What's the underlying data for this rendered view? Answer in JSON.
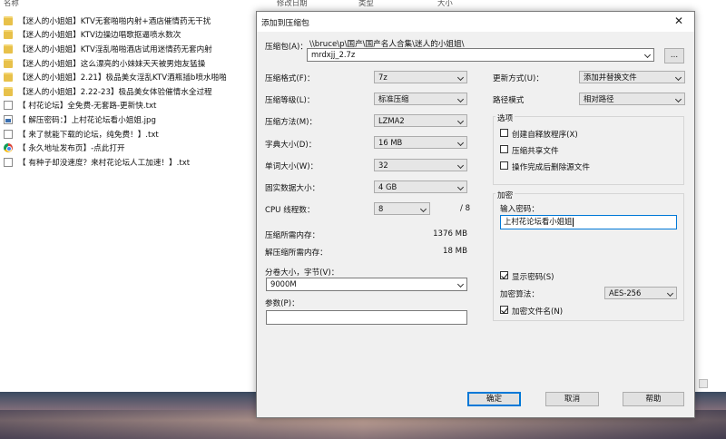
{
  "explorer": {
    "columns": [
      "名称",
      "修改日期",
      "类型",
      "大小"
    ],
    "files": [
      {
        "icon": "folder-icon",
        "name": "【迷人的小姐姐】KTV无套啪啪内射+酒店催情药无干扰"
      },
      {
        "icon": "folder-icon",
        "name": "【迷人的小姐姐】KTV边操边唱歌抠逼喷水数次"
      },
      {
        "icon": "folder-icon",
        "name": "【迷人的小姐姐】KTV淫乱啪啪酒店试用迷情药无套内射"
      },
      {
        "icon": "folder-icon",
        "name": "【迷人的小姐姐】这么漂亮的小妹妹天天被男炮友猛操"
      },
      {
        "icon": "folder-icon",
        "name": "【迷人的小姐姐】2.21】极品美女淫乱KTV酒瓶插b喷水啪啪"
      },
      {
        "icon": "folder-icon",
        "name": "【迷人的小姐姐】2.22-23】极品美女体验催情水全过程"
      },
      {
        "icon": "document-icon",
        "name": "【 村花论坛】全免费-无套路-更新快.txt"
      },
      {
        "icon": "image-icon",
        "name": "【 解压密码：】上村花论坛看小姐姐.jpg"
      },
      {
        "icon": "document-icon",
        "name": "【 来了就能下载的论坛，纯免费！】.txt"
      },
      {
        "icon": "chrome-icon",
        "name": "【 永久地址发布页】-点此打开"
      },
      {
        "icon": "document-icon",
        "name": "【 有种子却没速度？来村花论坛人工加速！】.txt"
      }
    ]
  },
  "dialog": {
    "title": "添加到压缩包",
    "close_symbol": "✕",
    "archive_label": "压缩包(A)：",
    "archive_path": "\\\\bruce\\p\\国产\\国产名人合集\\迷人的小姐姐\\",
    "archive_name": "mrdxjj_2.7z",
    "browse_label": "...",
    "left": {
      "format_label": "压缩格式(F)：",
      "format_value": "7z",
      "level_label": "压缩等级(L)：",
      "level_value": "标准压缩",
      "method_label": "压缩方法(M)：",
      "method_value": "LZMA2",
      "dict_label": "字典大小(D)：",
      "dict_value": "16 MB",
      "word_label": "单词大小(W)：",
      "word_value": "32",
      "solid_label": "固实数据大小：",
      "solid_value": "4 GB",
      "threads_label": "CPU 线程数：",
      "threads_value": "8",
      "threads_total": "/ 8",
      "mem_compress_label": "压缩所需内存：",
      "mem_compress_value": "1376 MB",
      "mem_decompress_label": "解压缩所需内存：",
      "mem_decompress_value": "18 MB",
      "split_label": "分卷大小，字节(V)：",
      "split_value": "9000M",
      "params_label": "参数(P)：",
      "params_value": ""
    },
    "right": {
      "update_label": "更新方式(U)：",
      "update_value": "添加并替换文件",
      "path_label": "路径模式",
      "path_value": "相对路径",
      "options_title": "选项",
      "opt_sfx": "创建自释放程序(X)",
      "opt_shared": "压缩共享文件",
      "opt_delete": "操作完成后删除源文件",
      "encryption_title": "加密",
      "password_label": "输入密码：",
      "password_value": "上村花论坛看小姐姐",
      "show_password": "显示密码(S)",
      "enc_method_label": "加密算法：",
      "enc_method_value": "AES-256",
      "encrypt_names": "加密文件名(N)"
    },
    "buttons": {
      "ok": "确定",
      "cancel": "取消",
      "help": "帮助"
    }
  }
}
